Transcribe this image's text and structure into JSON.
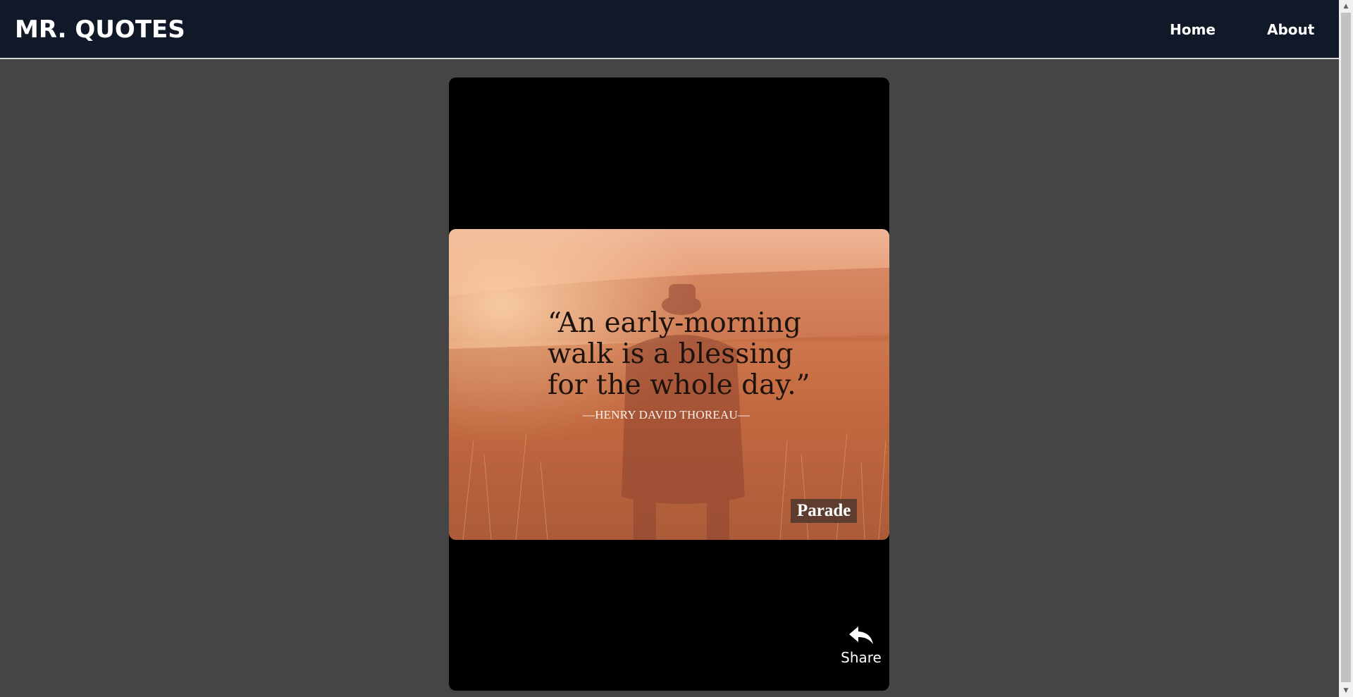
{
  "header": {
    "brand": "MR. QUOTES",
    "nav": [
      {
        "label": "Home"
      },
      {
        "label": "About"
      }
    ]
  },
  "quote_card": {
    "quote": "“An early-morning\nwalk is a blessing\nfor the whole day.”",
    "author": "—HENRY DAVID THOREAU—",
    "watermark": "Parade",
    "share_label": "Share",
    "share_icon": "share-reply-icon"
  },
  "colors": {
    "navbar_bg": "#111827",
    "page_bg": "#454545",
    "card_bg": "#000000",
    "image_tone": "#d9835a"
  }
}
